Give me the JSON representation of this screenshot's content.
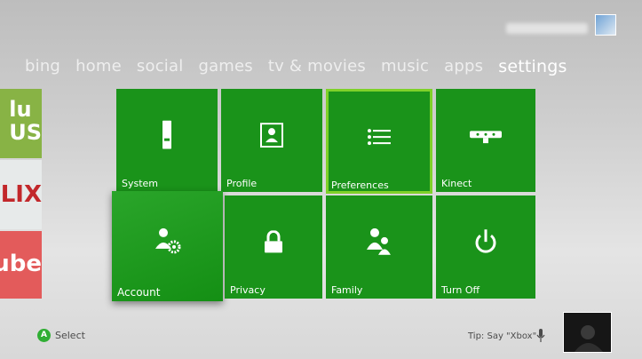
{
  "nav": {
    "items": [
      {
        "label": "bing"
      },
      {
        "label": "home"
      },
      {
        "label": "social"
      },
      {
        "label": "games"
      },
      {
        "label": "tv & movies"
      },
      {
        "label": "music"
      },
      {
        "label": "apps"
      },
      {
        "label": "settings"
      }
    ]
  },
  "side_tiles": {
    "hulu": "lu\nUS",
    "netflix": "FLIX",
    "youtube": "Tube"
  },
  "tiles": [
    {
      "label": "System",
      "icon": "console-icon"
    },
    {
      "label": "Profile",
      "icon": "profile-icon"
    },
    {
      "label": "Preferences",
      "icon": "list-icon"
    },
    {
      "label": "Kinect",
      "icon": "kinect-icon"
    },
    {
      "label": "Account",
      "icon": "account-settings-icon"
    },
    {
      "label": "Privacy",
      "icon": "lock-icon"
    },
    {
      "label": "Family",
      "icon": "family-icon"
    },
    {
      "label": "Turn Off",
      "icon": "power-icon"
    }
  ],
  "footer": {
    "a_button": "A",
    "select_label": "Select",
    "tip": "Tip: Say \"Xbox\""
  },
  "colors": {
    "tile_green": "#1a931a",
    "focus_outline": "#7fd12a",
    "a_button_green": "#2fae33"
  }
}
